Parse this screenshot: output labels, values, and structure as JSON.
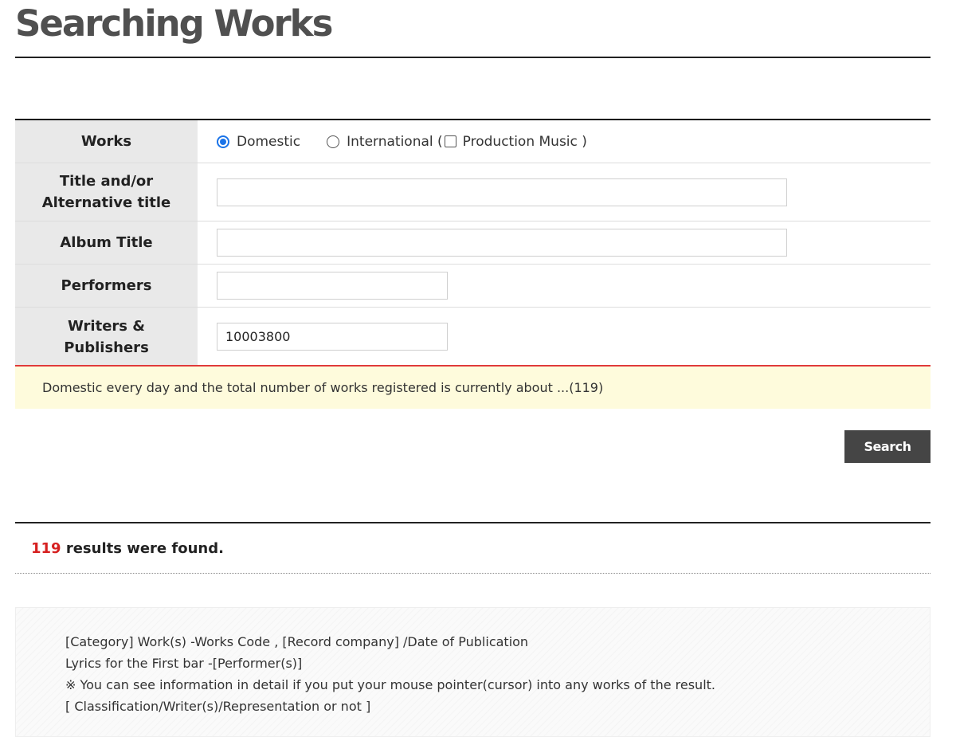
{
  "page": {
    "title": "Searching Works"
  },
  "form": {
    "works": {
      "label": "Works",
      "options": {
        "domestic": "Domestic",
        "international": "International (",
        "production_music": "Production Music )"
      },
      "selected": "Domestic"
    },
    "title": {
      "label_line1": "Title and/or",
      "label_line2": "Alternative title",
      "value": ""
    },
    "album": {
      "label": "Album Title",
      "value": ""
    },
    "performers": {
      "label": "Performers",
      "value": ""
    },
    "writers": {
      "label_line1": "Writers &",
      "label_line2": "Publishers",
      "value": "10003800"
    }
  },
  "notice": {
    "text": "Domestic every day and the total number of works registered is currently about ...(119)"
  },
  "search_button": {
    "label": "Search"
  },
  "results": {
    "count": "119",
    "text": " results were found."
  },
  "legend": {
    "lines": [
      "[Category] Work(s) -Works Code , [Record company] /Date of Publication",
      "Lyrics for the First bar -[Performer(s)]",
      "※ You can see information in detail if you put your mouse pointer(cursor) into any works of the result.",
      "[ Classification/Writer(s)/Representation or not ]"
    ]
  },
  "colors": {
    "accent_blue": "#1a73e8",
    "notice_border": "#e03a3a",
    "notice_bg": "#fefbdc",
    "count_red": "#d61f1f",
    "button_bg": "#454545"
  }
}
